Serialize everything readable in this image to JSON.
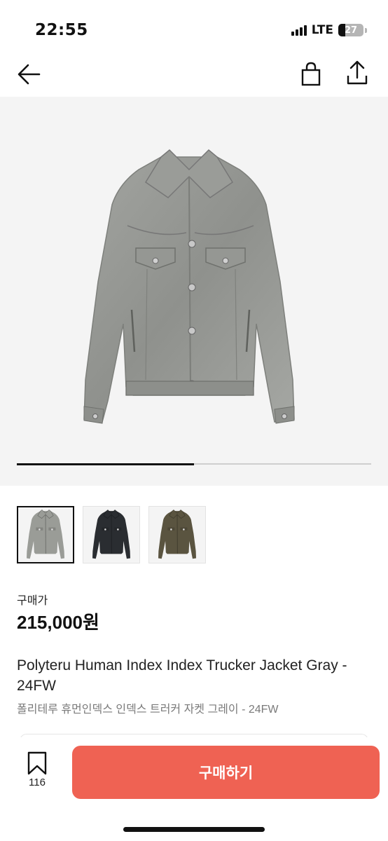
{
  "status_bar": {
    "time": "22:55",
    "network": "LTE",
    "battery": "27"
  },
  "nav": {
    "back_icon": "arrow-left-icon",
    "bag_icon": "shopping-bag-icon",
    "share_icon": "share-icon"
  },
  "gallery": {
    "progress": 0.5,
    "thumbnails": [
      {
        "color_name": "gray",
        "color": "#9a9c97"
      },
      {
        "color_name": "black",
        "color": "#2a2d31"
      },
      {
        "color_name": "khaki",
        "color": "#5a5440"
      }
    ]
  },
  "product": {
    "price_label": "구매가",
    "price": "215,000원",
    "name_en": "Polyteru Human Index Index Trucker Jacket Gray - 24FW",
    "name_ko": "폴리테루 휴먼인덱스 인덱스 트러커 자켓 그레이 - 24FW"
  },
  "bottom": {
    "bookmark_count": "116",
    "buy_label": "구매하기"
  },
  "colors": {
    "accent": "#ef6253",
    "hero_bg": "#f4f4f4"
  }
}
